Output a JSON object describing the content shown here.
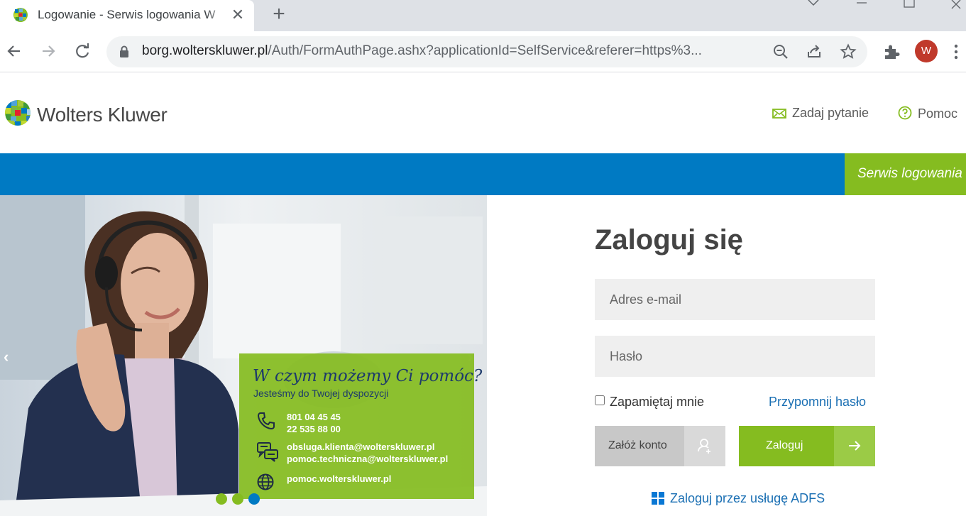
{
  "browser": {
    "tab_title": "Logowanie - Serwis logowania W",
    "url_host": "borg.wolterskluwer.pl",
    "url_rest": "/Auth/FormAuthPage.ashx?applicationId=SelfService&referer=https%3...",
    "profile_initial": "W"
  },
  "header": {
    "brand": "Wolters Kluwer",
    "ask_question": "Zadaj pytanie",
    "help": "Pomoc",
    "service_label": "Serwis logowania"
  },
  "carousel": {
    "prev": "‹",
    "next": "›",
    "promo_title": "W czym możemy Ci pomóc?",
    "promo_subtitle": "Jesteśmy do Twojej dyspozycji",
    "phone_1": "801 04 45 45",
    "phone_2": "22 535 88 00",
    "email_1": "obsluga.klienta@wolterskluwer.pl",
    "email_2": "pomoc.techniczna@wolterskluwer.pl",
    "website": "pomoc.wolterskluwer.pl",
    "slides_active": 3,
    "slides_total": 3
  },
  "login": {
    "title": "Zaloguj się",
    "email_placeholder": "Adres e-mail",
    "password_placeholder": "Hasło",
    "remember_me": "Zapamiętaj mnie",
    "remind_password": "Przypomnij hasło",
    "register": "Załóż konto",
    "submit": "Zaloguj",
    "adfs": "Zaloguj przez usługę ADFS"
  },
  "colors": {
    "blue": "#007ac3",
    "green": "#85bc20",
    "link": "#1a6fb3"
  }
}
